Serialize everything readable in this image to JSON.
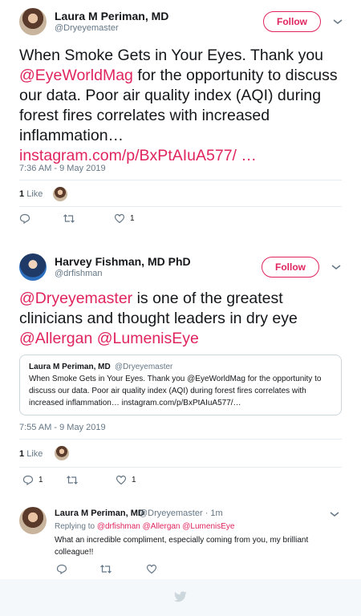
{
  "tweet1": {
    "author_name": "Laura M Periman, MD",
    "author_handle": "@Dryeyemaster",
    "follow_label": "Follow",
    "text_1": "When Smoke Gets in Your Eyes. Thank you ",
    "mention": "@EyeWorldMag",
    "text_2": " for the opportunity to discuss our data. Poor air quality index (AQI) during forest fires correlates with increased inflammation…",
    "link": "instagram.com/p/BxPtAIuA577/ …",
    "timestamp": "7:36 AM - 9 May 2019",
    "likes_count": "1",
    "likes_label": "Like",
    "like_action_count": "1"
  },
  "tweet2": {
    "author_name": "Harvey Fishman, MD PhD",
    "author_handle": "@drfishman",
    "follow_label": "Follow",
    "mention_1": "@Dryeyemaster",
    "text_1": " is one of the greatest clinicians and thought leaders in dry eye ",
    "mention_2": "@Allergan",
    "space": " ",
    "mention_3": "@LumenisEye",
    "quote": {
      "author_name": "Laura M Periman, MD",
      "author_handle": "@Dryeyemaster",
      "text": "When Smoke Gets in Your Eyes. Thank you @EyeWorldMag for the opportunity to discuss our data. Poor air quality index (AQI) during forest fires correlates with increased inflammation… instagram.com/p/BxPtAIuA577/…"
    },
    "timestamp": "7:55 AM - 9 May 2019",
    "likes_count": "1",
    "likes_label": "Like",
    "reply_count": "1",
    "like_action_count": "1"
  },
  "reply": {
    "author_name": "Laura M Periman, MD",
    "author_handle": "@Dryeyemaster",
    "time": "· 1m",
    "replying_to_label": "Replying to",
    "replying_to_1": "@drfishman",
    "replying_to_2": "@Allergan",
    "replying_to_3": "@LumenisEye",
    "text": "What an incredible compliment, especially coming from you, my brilliant colleague!!"
  },
  "colors": {
    "accent": "#e0245e",
    "muted": "#657786",
    "divider": "#e6ecf0",
    "twitter_blue": "#1da1f2"
  }
}
